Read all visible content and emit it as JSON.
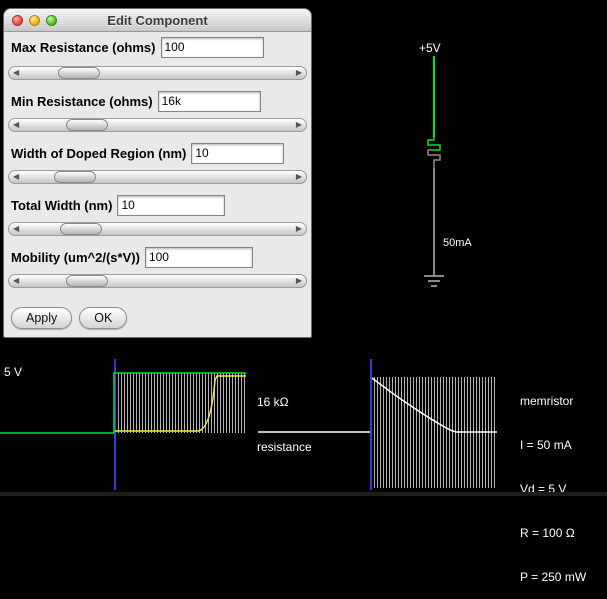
{
  "dialog": {
    "title": "Edit Component",
    "fields": [
      {
        "label": "Max Resistance (ohms)",
        "value": "100"
      },
      {
        "label": "Min Resistance (ohms)",
        "value": "16k"
      },
      {
        "label": "Width of Doped Region (nm)",
        "value": "10"
      },
      {
        "label": "Total Width (nm)",
        "value": "10"
      },
      {
        "label": "Mobility (um^2/(s*V))",
        "value": "100"
      }
    ],
    "apply_label": "Apply",
    "ok_label": "OK"
  },
  "icons": {
    "arrow_left": "◀",
    "arrow_right": "▶"
  },
  "circuit": {
    "voltage_label": "+5V",
    "current_label": "50mA"
  },
  "scopes": {
    "voltage_scope_label": "5 V",
    "resistance_value_label": "16 kΩ",
    "resistance_name_label": "resistance",
    "info_lines": [
      "memristor",
      "I = 50 mA",
      "Vd = 5 V",
      "R = 100 Ω",
      "P = 250 mW"
    ]
  },
  "colors": {
    "voltage_trace": "#00e32a",
    "current_trace": "#f0e846",
    "resistance_trace": "#ffffff",
    "sweep_marker": "#3a3ad6",
    "wire_gray": "#8a8a8a"
  }
}
